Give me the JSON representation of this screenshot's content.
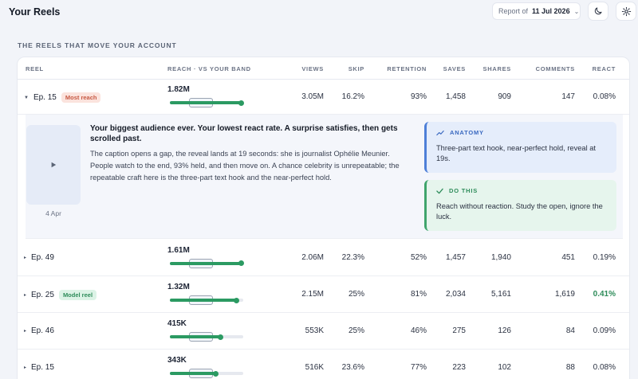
{
  "header": {
    "title": "Your Reels",
    "report_label": "Report of",
    "report_date": "11 Jul 2026"
  },
  "section": {
    "title": "THE REELS THAT MOVE YOUR ACCOUNT"
  },
  "table": {
    "columns": {
      "reel": "REEL",
      "reach": "REACH · VS YOUR BAND",
      "views": "VIEWS",
      "skip": "SKIP",
      "retention": "RETENTION",
      "saves": "SAVES",
      "shares": "SHARES",
      "comments": "COMMENTS",
      "react": "REACT"
    },
    "rows": [
      {
        "name": "Ep. 15",
        "badge": "Most reach",
        "reach": "1.82M",
        "reach_fraction": 0.97,
        "views": "3.05M",
        "skip": "16.2%",
        "retention": "93%",
        "saves": "1,458",
        "shares": "909",
        "comments": "147",
        "react": "0.08%"
      },
      {
        "name": "Ep. 49",
        "badge": "",
        "reach": "1.61M",
        "reach_fraction": 0.97,
        "views": "2.06M",
        "skip": "22.3%",
        "retention": "52%",
        "saves": "1,457",
        "shares": "1,940",
        "comments": "451",
        "react": "0.19%"
      },
      {
        "name": "Ep. 25",
        "badge": "Model reel",
        "reach": "1.32M",
        "reach_fraction": 0.9,
        "views": "2.15M",
        "skip": "25%",
        "retention": "81%",
        "saves": "2,034",
        "shares": "5,161",
        "comments": "1,619",
        "react": "0.41%"
      },
      {
        "name": "Ep. 46",
        "badge": "",
        "reach": "415K",
        "reach_fraction": 0.68,
        "views": "553K",
        "skip": "25%",
        "retention": "46%",
        "saves": "275",
        "shares": "126",
        "comments": "84",
        "react": "0.09%"
      },
      {
        "name": "Ep. 15",
        "badge": "",
        "reach": "343K",
        "reach_fraction": 0.62,
        "views": "516K",
        "skip": "23.6%",
        "retention": "77%",
        "saves": "223",
        "shares": "102",
        "comments": "88",
        "react": "0.08%"
      }
    ]
  },
  "expanded": {
    "thumb_date": "4 Apr",
    "headline": "Your biggest audience ever. Your lowest react rate. A surprise satisfies, then gets scrolled past.",
    "body": "The caption opens a gap, the reveal lands at 19 seconds: she is journalist Ophélie Meunier. People watch to the end, 93% held, and then move on. A chance celebrity is unrepeatable; the repeatable craft here is the three-part text hook and the near-perfect hold.",
    "anatomy_title": "ANATOMY",
    "anatomy_text": "Three-part text hook, near-perfect hold, reveal at 19s.",
    "do_title": "DO THIS",
    "do_text": "Reach without reaction. Study the open, ignore the luck."
  },
  "colors": {
    "accent_green": "#2b9a62",
    "accent_blue": "#4d7fd8",
    "badge_reach": "#c75a44"
  },
  "icons": [
    "moon-icon",
    "gear-icon",
    "chevron-down-icon",
    "play-icon",
    "trend-icon",
    "check-icon",
    "caret-icon"
  ]
}
